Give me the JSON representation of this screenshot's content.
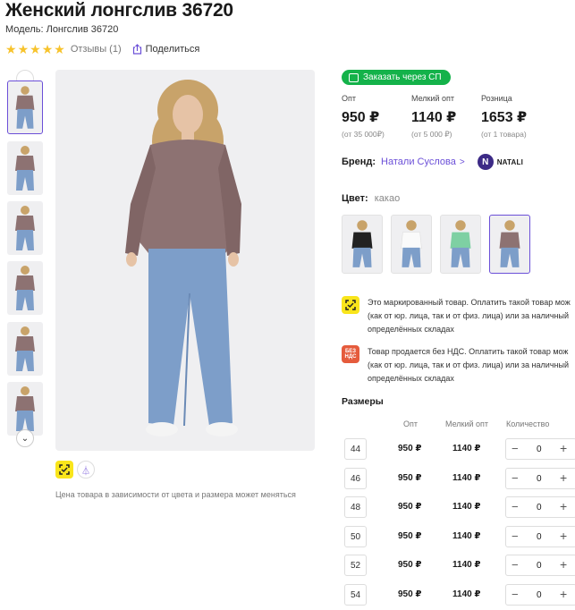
{
  "product": {
    "title": "Женский лонгслив 36720",
    "model": "Модель: Лонгслив 36720",
    "reviews": "Отзывы (1)",
    "share": "Поделиться",
    "stars": 5,
    "price_note": "Цена товара в зависимости от цвета и размера может меняться"
  },
  "order_button": "Заказать через СП",
  "prices": [
    {
      "label": "Опт",
      "value": "950 ₽",
      "min": "(от 35 000₽)"
    },
    {
      "label": "Мелкий опт",
      "value": "1140 ₽",
      "min": "(от 5 000 ₽)"
    },
    {
      "label": "Розница",
      "value": "1653 ₽",
      "min": "(от 1 товара)"
    }
  ],
  "brand": {
    "label": "Бренд:",
    "name": "Натали Суслова",
    "logo_letter": "N",
    "logo_text": "NATALI"
  },
  "color": {
    "label": "Цвет:",
    "value": "какао",
    "swatches": [
      "black",
      "white",
      "mint",
      "cocoa"
    ]
  },
  "notices": [
    {
      "icon": "honest-sign-icon",
      "lines": [
        "Это маркированный товар. Оплатить такой товар мож",
        "(как от юр. лица, так и от физ. лица) или за наличный",
        "определённых складах"
      ]
    },
    {
      "icon": "no-vat-icon",
      "icon_text": [
        "БЕЗ",
        "НДС"
      ],
      "lines": [
        "Товар продается без НДС. Оплатить такой товар мож",
        "(как от юр. лица, так и от физ. лица) или за наличный",
        "определённых складах"
      ]
    }
  ],
  "sizes": {
    "title": "Размеры",
    "headers": {
      "opt": "Опт",
      "small_opt": "Мелкий опт",
      "qty": "Количество"
    },
    "rows": [
      {
        "size": "44",
        "opt": "950 ₽",
        "small_opt": "1140 ₽",
        "qty": "0"
      },
      {
        "size": "46",
        "opt": "950 ₽",
        "small_opt": "1140 ₽",
        "qty": "0"
      },
      {
        "size": "48",
        "opt": "950 ₽",
        "small_opt": "1140 ₽",
        "qty": "0"
      },
      {
        "size": "50",
        "opt": "950 ₽",
        "small_opt": "1140 ₽",
        "qty": "0"
      },
      {
        "size": "52",
        "opt": "950 ₽",
        "small_opt": "1140 ₽",
        "qty": "0"
      },
      {
        "size": "54",
        "opt": "950 ₽",
        "small_opt": "1140 ₽",
        "qty": "0"
      }
    ],
    "minus": "−",
    "plus": "+"
  },
  "colors": {
    "accent": "#6b4fd8",
    "green": "#14b24a",
    "star": "#f7c32c",
    "honest_yellow": "#f9e51b",
    "novat_orange": "#e55b3c",
    "top_cocoa": "#8d7272",
    "jeans": "#7d9ec9"
  }
}
